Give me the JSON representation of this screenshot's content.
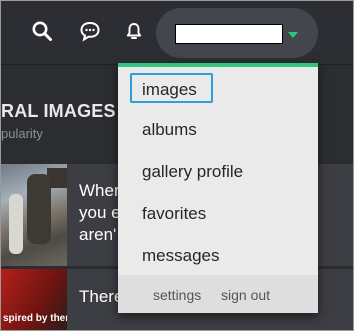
{
  "header": {
    "icons": [
      "search-icon",
      "chat-icon",
      "bell-icon"
    ],
    "user": {
      "name_field_value": "",
      "caret_color": "#31c47f"
    }
  },
  "background": {
    "section_title": "RAL IMAGES",
    "section_subtitle": "pularity",
    "posts": [
      {
        "title": "Wher you e aren'",
        "thumb_caption": ""
      },
      {
        "title": "There",
        "thumb_caption": "spired by them."
      }
    ]
  },
  "menu": {
    "accent_color": "#31c47f",
    "selected_border_color": "#2d9fd9",
    "items": [
      {
        "label": "images",
        "selected": true
      },
      {
        "label": "albums"
      },
      {
        "label": "gallery profile"
      },
      {
        "label": "favorites"
      },
      {
        "label": "messages"
      }
    ],
    "footer": {
      "settings_label": "settings",
      "signout_label": "sign out"
    }
  }
}
